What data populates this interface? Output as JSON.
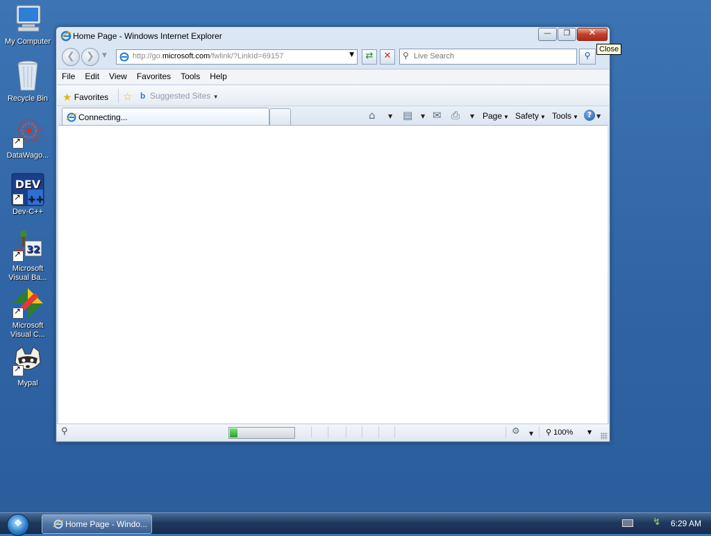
{
  "desktop": {
    "icons": [
      {
        "label": "My Computer",
        "icon": "computer-icon"
      },
      {
        "label": "Recycle Bin",
        "icon": "recycle-bin-icon"
      },
      {
        "label": "DataWago...",
        "icon": "datawagon-icon"
      },
      {
        "label": "Dev-C++",
        "icon": "dev-cpp-icon",
        "badge": "DEV"
      },
      {
        "label_line1": "Microsoft",
        "label_line2": "Visual Ba...",
        "icon": "visual-basic-icon",
        "badge": "32"
      },
      {
        "label_line1": "Microsoft",
        "label_line2": "Visual C...",
        "icon": "visual-c-icon"
      },
      {
        "label": "Mypal",
        "icon": "mypal-raccoon-icon"
      }
    ]
  },
  "window": {
    "title": "Home Page - Windows Internet Explorer",
    "tooltip": "Close",
    "address": {
      "prefix": "http://go.",
      "domain": "microsoft.com",
      "suffix": "/fwlink/?LinkId=69157"
    },
    "search_placeholder": "Live Search",
    "menu": [
      "File",
      "Edit",
      "View",
      "Favorites",
      "Tools",
      "Help"
    ],
    "favorites_label": "Favorites",
    "suggested_sites": "Suggested Sites",
    "tab_label": "Connecting...",
    "commands": {
      "page": "Page",
      "safety": "Safety",
      "tools": "Tools"
    },
    "status": {
      "zoom": "100%",
      "progress": 0.12
    }
  },
  "taskbar": {
    "task_label": "Home Page - Windo...",
    "clock": "6:29 AM"
  },
  "colors": {
    "desktop": "#3a6ea5",
    "close_button": "#c2402a",
    "progress_fill": "#22a322"
  }
}
